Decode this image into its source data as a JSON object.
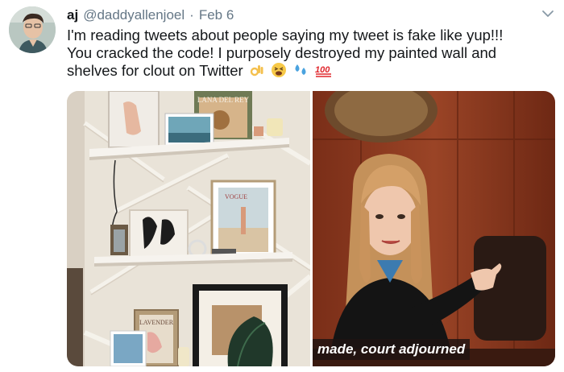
{
  "author": {
    "display_name": "aj",
    "handle": "@daddyallenjoel",
    "separator": "·",
    "date": "Feb 6"
  },
  "tweet": {
    "lines": [
      "I'm reading tweets about people saying my tweet is fake like yup!!!",
      "You cracked the code! I purposely destroyed my painted wall and",
      "shelves for clout on Twitter"
    ],
    "emojis": [
      "ok-hand-emoji",
      "tired-face-emoji",
      "sweat-droplets-emoji",
      "hundred-points-emoji"
    ]
  },
  "media": {
    "left_image": {
      "album_label": "LANA DEL REY",
      "poster_label": "VOGUE",
      "book_label": "LAVENDER"
    },
    "right_image": {
      "caption": "made, court adjourned"
    }
  },
  "colors": {
    "text": "#14171a",
    "secondary": "#657786",
    "wall": "#e7e1d6",
    "wood_panel": "#8a3a20"
  }
}
